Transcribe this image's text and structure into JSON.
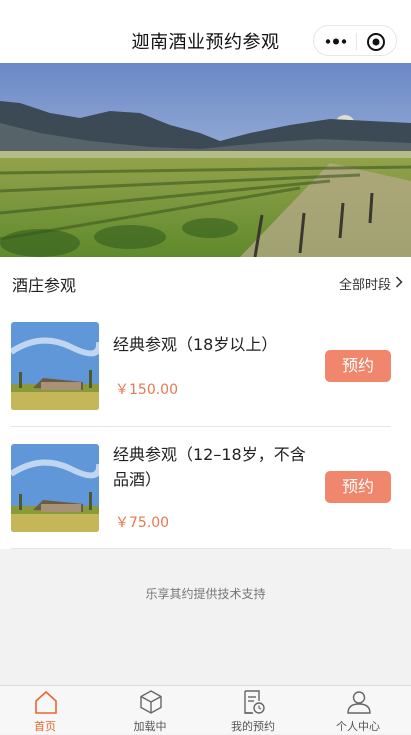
{
  "nav": {
    "title": "迦南酒业预约参观"
  },
  "section": {
    "title": "酒庄参观",
    "more_label": "全部时段"
  },
  "items": [
    {
      "name": "经典参观（18岁以上）",
      "price": "￥150.00",
      "button": "预约"
    },
    {
      "name": "经典参观（12–18岁，不含品酒）",
      "price": "￥75.00",
      "button": "预约"
    }
  ],
  "footer": {
    "support_text": "乐享其约提供技术支持"
  },
  "tabbar": [
    {
      "label": "首页",
      "icon": "home-icon",
      "active": true
    },
    {
      "label": "加载中",
      "icon": "cube-icon",
      "active": false
    },
    {
      "label": "我的预约",
      "icon": "booking-icon",
      "active": false
    },
    {
      "label": "个人中心",
      "icon": "user-icon",
      "active": false
    }
  ],
  "colors": {
    "accent": "#e8672f",
    "button": "#f0866b",
    "price": "#e8784f"
  }
}
